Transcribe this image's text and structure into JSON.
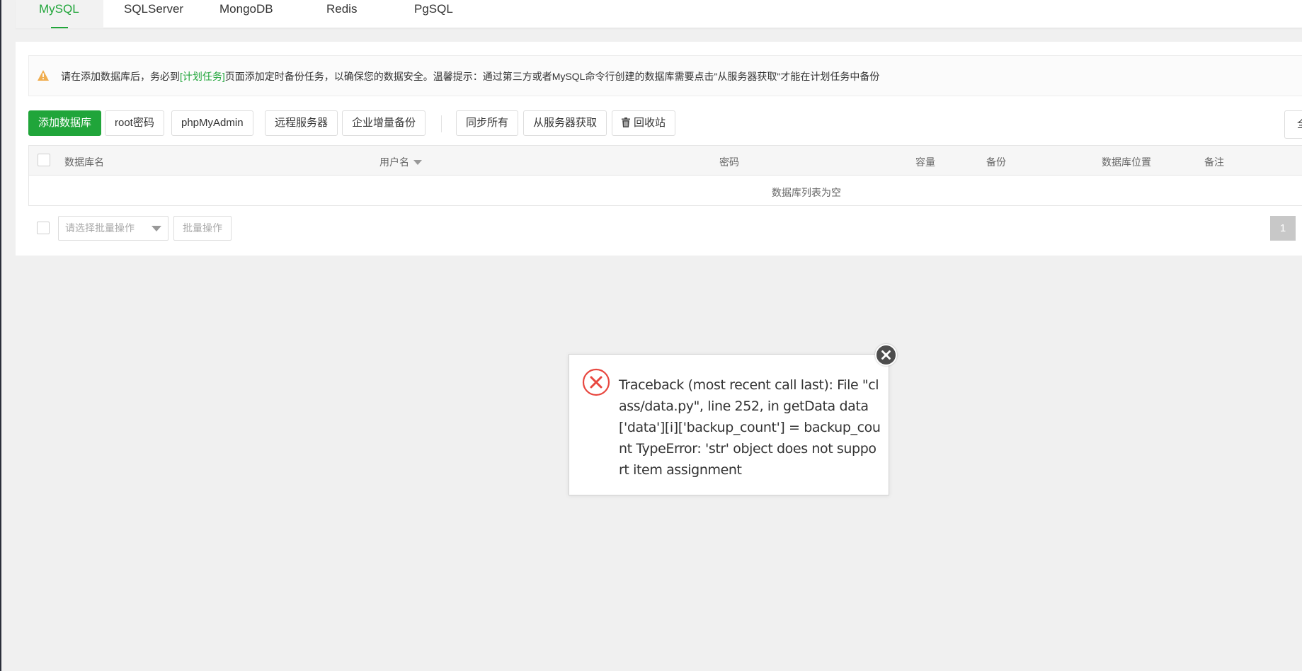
{
  "tabs": [
    {
      "label": "MySQL",
      "active": true
    },
    {
      "label": "SQLServer"
    },
    {
      "label": "MongoDB"
    },
    {
      "label": "Redis"
    },
    {
      "label": "PgSQL"
    }
  ],
  "alert": {
    "text_before": "请在添加数据库后，务必到",
    "link": "[计划任务]",
    "text_after": "页面添加定时备份任务，以确保您的数据安全。温馨提示：通过第三方或者MySQL命令行创建的数据库需要点击\"从服务器获取\"才能在计划任务中备份",
    "icon": "warning-icon",
    "icon_color": "#f0ad4e"
  },
  "toolbar": {
    "add_db": "添加数据库",
    "root_pwd": "root密码",
    "phpmyadmin": "phpMyAdmin",
    "remote_server": "远程服务器",
    "incremental_backup": "企业增量备份",
    "sync_all": "同步所有",
    "fetch_from_server": "从服务器获取",
    "recycle_bin": "回收站",
    "edge_button": "全"
  },
  "table": {
    "columns": [
      "数据库名",
      "用户名",
      "密码",
      "容量",
      "备份",
      "数据库位置",
      "备注"
    ],
    "empty_text": "数据库列表为空"
  },
  "footer": {
    "batch_select_placeholder": "请选择批量操作",
    "batch_button": "批量操作",
    "page": "1"
  },
  "dialog": {
    "message": "Traceback (most recent call last): File \"class/data.py\", line 252, in getData data['data'][i]['backup_count'] = backup_count TypeError: 'str' object does not support item assignment",
    "icon": "error-icon",
    "icon_color": "#e8473f"
  },
  "colors": {
    "accent": "#20a53a",
    "page_bg": "#f0f0f0"
  }
}
